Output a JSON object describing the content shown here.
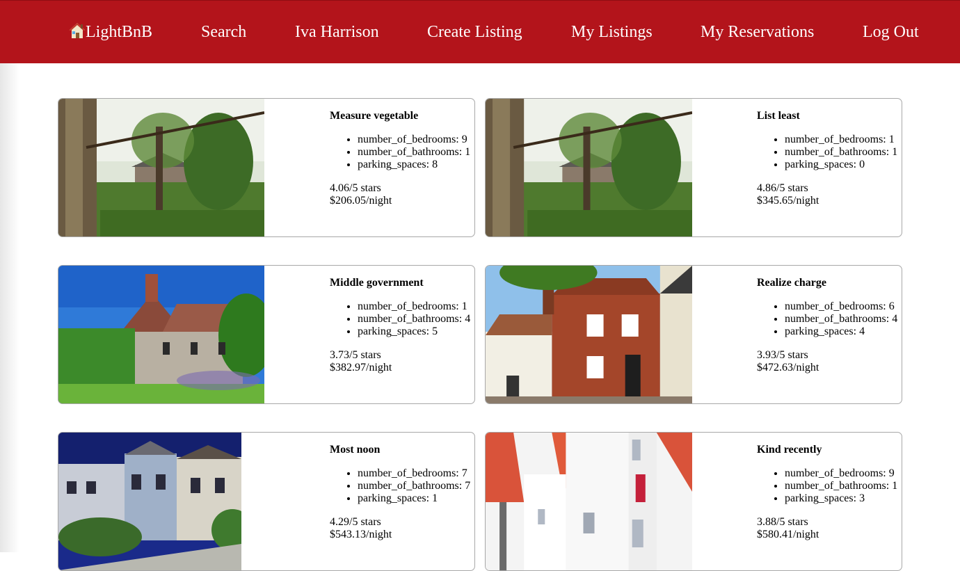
{
  "nav": {
    "logo": "LightBnB",
    "search": "Search",
    "user": "Iva Harrison",
    "create": "Create Listing",
    "my_listings": "My Listings",
    "my_reservations": "My Reservations",
    "logout": "Log Out"
  },
  "colors": {
    "header": "#b3141b",
    "text": "#000000",
    "nav_text": "#ffffff"
  },
  "listings": [
    {
      "title": "Measure vegetable",
      "bedrooms": "number_of_bedrooms: 9",
      "bathrooms": "number_of_bathrooms: 1",
      "parking": "parking_spaces: 8",
      "rating": "4.06/5 stars",
      "price": "$206.05/night",
      "image": "garden-house-photo"
    },
    {
      "title": "List least",
      "bedrooms": "number_of_bedrooms: 1",
      "bathrooms": "number_of_bathrooms: 1",
      "parking": "parking_spaces: 0",
      "rating": "4.86/5 stars",
      "price": "$345.65/night",
      "image": "garden-house-photo"
    },
    {
      "title": "Middle government",
      "bedrooms": "number_of_bedrooms: 1",
      "bathrooms": "number_of_bathrooms: 4",
      "parking": "parking_spaces: 5",
      "rating": "3.73/5 stars",
      "price": "$382.97/night",
      "image": "country-cottage-photo"
    },
    {
      "title": "Realize charge",
      "bedrooms": "number_of_bedrooms: 6",
      "bathrooms": "number_of_bathrooms: 4",
      "parking": "parking_spaces: 4",
      "rating": "3.93/5 stars",
      "price": "$472.63/night",
      "image": "brick-townhouse-photo"
    },
    {
      "title": "Most noon",
      "bedrooms": "number_of_bedrooms: 7",
      "bathrooms": "number_of_bathrooms: 7",
      "parking": "parking_spaces: 1",
      "rating": "4.29/5 stars",
      "price": "$543.13/night",
      "image": "victorian-row-houses-photo"
    },
    {
      "title": "Kind recently",
      "bedrooms": "number_of_bedrooms: 9",
      "bathrooms": "number_of_bathrooms: 1",
      "parking": "parking_spaces: 3",
      "rating": "3.88/5 stars",
      "price": "$580.41/night",
      "image": "white-gabled-houses-photo"
    }
  ]
}
